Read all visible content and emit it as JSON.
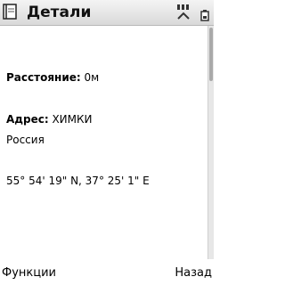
{
  "header": {
    "title": "Детали",
    "app_icon": "book-icon",
    "indicators": [
      "signal-icon",
      "battery-icon"
    ]
  },
  "details": {
    "distance_label": "Расстояние:",
    "distance_value": "0м",
    "address_label": "Адрес:",
    "address_value": "ХИМКИ",
    "country": "Россия",
    "coordinates": "55° 54' 19\" N, 37° 25' 1\" E"
  },
  "softkeys": {
    "left": "Функции",
    "right": "Назад"
  }
}
